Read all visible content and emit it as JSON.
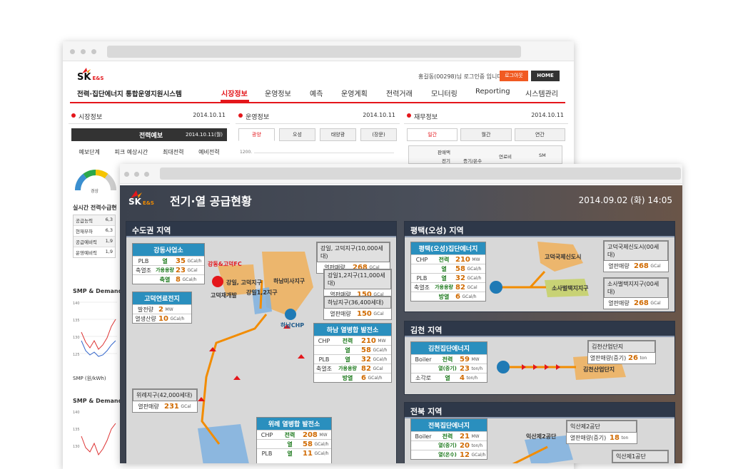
{
  "back": {
    "brand_sk": "SK",
    "brand_es": "E&S",
    "system_title": "전력·집단에너지 통합운영지원시스템",
    "login_text": "홍길동(00298)님 로그인중 입니다.",
    "logout_label": "로그아웃",
    "home_label": "HOME",
    "nav": [
      "시장정보",
      "운영정보",
      "예측",
      "운영계획",
      "전력거래",
      "모니터링",
      "Reporting",
      "시스템관리"
    ],
    "p1": {
      "title": "시장정보",
      "date": "2014.10.11",
      "forecast_title": "전력예보",
      "forecast_date": "2014.10.11(월)",
      "cols": [
        "예보단계",
        "피크 예상시간",
        "최대전력",
        "예비전력"
      ],
      "market_title": "실시간 전력수급현",
      "market_rows": [
        "공급능력",
        "현재부하",
        "공급예비력",
        "운영예비력"
      ],
      "market_vals": [
        "6,3",
        "6,3",
        "1,9",
        "1,9"
      ],
      "smp1": "SMP & Demand",
      "smp_unit": "SMP (원/kWh)",
      "smp2": "SMP & Demand",
      "y_ticks": [
        "140",
        "135",
        "130",
        "125",
        "120"
      ],
      "gauge_label": "경상"
    },
    "p2": {
      "title": "운영정보",
      "date": "2014.10.11",
      "tabs": [
        "광양",
        "오성",
        "태양광",
        "(장문)"
      ],
      "y_tick": "1200."
    },
    "p3": {
      "title": "재무정보",
      "date": "2014.10.11",
      "tabs": [
        "일간",
        "월간",
        "연간"
      ],
      "c1": "판매액",
      "c2": "연료비",
      "c3": "SM",
      "c4": "전기",
      "c5": "증기/온수"
    }
  },
  "front": {
    "brand_sk": "SK",
    "brand_es": "E&S",
    "title": "전기·열 공급현황",
    "datetime": "2014.09.02 (화) 14:05",
    "metro": {
      "title": "수도권 지역",
      "gangdong": {
        "title": "강동사업소",
        "r1": "PLB",
        "r1s": "열",
        "r1v": "35",
        "r1u": "GCal/h",
        "r2": "축열조",
        "r2s": "가용용량",
        "r2v": "23",
        "r2u": "GCal",
        "r3s": "축열",
        "r3v": "8",
        "r3u": "GCal/h"
      },
      "godeok": {
        "title": "고덕연료전지",
        "r1": "발전량",
        "r1v": "2",
        "r1u": "MW",
        "r2": "열생산량",
        "r2v": "10",
        "r2u": "GCal/h"
      },
      "gangil": {
        "title": "강일, 고덕지구(10,000세대)",
        "k": "열판매량",
        "v": "268",
        "u": "GCal"
      },
      "gangil12": {
        "title": "강일1,2지구(11,000세대)",
        "k": "열판매량",
        "v": "150",
        "u": "GCal"
      },
      "hanam": {
        "title": "하남지구(36,400세대)",
        "k": "열판매량",
        "v": "150",
        "u": "GCal"
      },
      "hanamplant": {
        "title": "하남 열병합 발전소",
        "chp": "CHP",
        "chp_s": "전력",
        "chp_v": "210",
        "chp_u": "MW",
        "chp2_s": "열",
        "chp2_v": "58",
        "chp2_u": "GCal/h",
        "plb": "PLB",
        "plb_s": "열",
        "plb_v": "32",
        "plb_u": "GCal/h",
        "st": "축열조",
        "st1_s": "가용용량",
        "st1_v": "82",
        "st1_u": "GCal",
        "st2_s": "방열",
        "st2_v": "6",
        "st2_u": "GCal/h"
      },
      "wirye": {
        "title": "위례지구(42,000세대)",
        "k": "열판매량",
        "v": "231",
        "u": "GCal"
      },
      "wiryeplant": {
        "title": "위례 열병합 발전소",
        "chp": "CHP",
        "chp_s": "전력",
        "chp_v": "208",
        "chp_u": "MW",
        "chp2_s": "열",
        "chp2_v": "58",
        "chp2_u": "GCal/h",
        "plb": "PLB",
        "plb_s": "열",
        "plb_v": "11",
        "plb_u": "GCal/h"
      },
      "labels": {
        "fc": "강동&고덕FC",
        "gangil_label": "강일, 고덕지구",
        "hanam_misa": "하남미사지구",
        "godeok_dev": "고덕재개발",
        "gangil12_label": "강일1,2지구",
        "hanam_chp": "하남CHP"
      }
    },
    "pt": {
      "title": "평택(오성) 지역",
      "plant": "평택(오성)집단에너지",
      "chp": "CHP",
      "chp_s": "전력",
      "chp_v": "210",
      "chp_u": "MW",
      "chp2_s": "열",
      "chp2_v": "58",
      "chp2_u": "GCal/h",
      "plb": "PLB",
      "plb_s": "열",
      "plb_v": "32",
      "plb_u": "GCal/h",
      "st": "축열조",
      "st1_s": "가용용량",
      "st1_v": "82",
      "st1_u": "GCal",
      "st2_s": "방열",
      "st2_v": "6",
      "st2_u": "GCal/h",
      "c1": {
        "title": "고덕국제신도시(00세대)",
        "k": "열판매량",
        "v": "268",
        "u": "GCal"
      },
      "c2": {
        "title": "소사벌택지지구(00세대)",
        "k": "열판매량",
        "v": "268",
        "u": "GCal"
      },
      "l1": "고덕국제신도시",
      "l2": "소사벌택지지구"
    },
    "gc": {
      "title": "김천 지역",
      "plant": "김천집단에너지",
      "boiler": "Boiler",
      "b1_s": "전력",
      "b1_v": "59",
      "b1_u": "MW",
      "b2_s": "열(증기)",
      "b2_v": "23",
      "b2_u": "ton/h",
      "inc": "소각로",
      "inc_s": "열",
      "inc_v": "4",
      "inc_u": "ton/h",
      "c1": {
        "title": "김천산업단지",
        "k": "열판매량(증기)",
        "v": "26",
        "u": "ton"
      },
      "l1": "김천산업단지"
    },
    "jb": {
      "title": "전북 지역",
      "plant": "전북집단에너지",
      "boiler": "Boiler",
      "b1_s": "전력",
      "b1_v": "21",
      "b1_u": "MW",
      "b2_s": "열(증기)",
      "b2_v": "20",
      "b2_u": "ton/h",
      "b3_s": "열(온수)",
      "b3_v": "12",
      "b3_u": "GCal/h",
      "c1": {
        "title": "익산제2공단",
        "k": "열판매량(증기)",
        "v": "18",
        "u": "ton"
      },
      "c2": {
        "title": "익산제1공단"
      },
      "l1": "익산제2공단"
    }
  }
}
